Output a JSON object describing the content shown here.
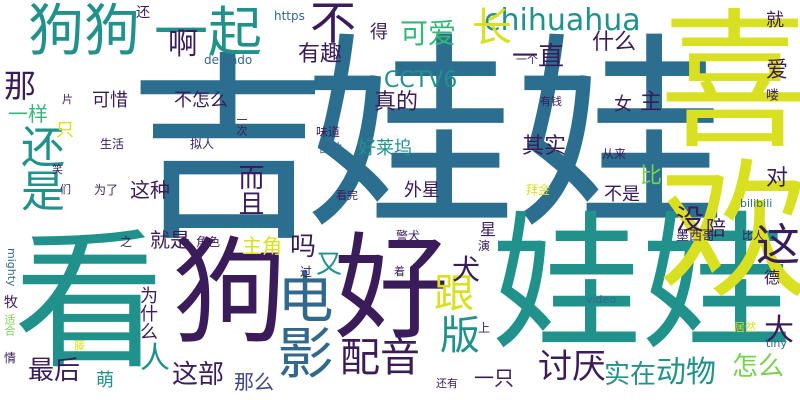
{
  "palette": {
    "teal_dark": "#2c6e8f",
    "teal": "#21918c",
    "green": "#35b779",
    "lime": "#7ad151",
    "yellow": "#d9e021",
    "purple": "#3b1c5a",
    "indigo": "#414487",
    "blue": "#31688e"
  },
  "words": {
    "ji": "吉",
    "wawa1": "娃娃",
    "wawa2": "娃娃",
    "xihuan": "喜欢",
    "kan": "看",
    "gou": "狗",
    "hao": "好",
    "gougou": "狗狗",
    "yiqi": "一起",
    "bu": "不",
    "chihuahua": "chihuahua",
    "haishi": "还是",
    "dianying": "电影",
    "zhe": "这",
    "peiyin": "配音",
    "ban": "版",
    "gen": "跟",
    "quan": "犬",
    "taoyan": "讨厌",
    "dongwu": "动物",
    "shizai": "实在",
    "zenme": "怎么",
    "da": "大",
    "zuihou": "最后",
    "zhebu": "这部",
    "name": "那么",
    "ren": "人",
    "mei": "没",
    "ma": "吗",
    "you": "又",
    "youqu": "有趣",
    "cctv6": "CCTV6",
    "a": "啊",
    "keai": "可爱",
    "chang": "长",
    "yizhi": "一直",
    "shenme": "什么",
    "na": "那",
    "yiyang": "一样",
    "kexi": "可惜",
    "buzenme": "不怎么",
    "zhende": "真的",
    "qishi": "其实",
    "haolaiwu": "好莱坞",
    "waixing": "外星",
    "bushi": "不是",
    "zhezhong": "这种",
    "erqie": "而且",
    "jiushi": "就是",
    "zhujiao": "主角",
    "weishenme": "为什么",
    "yizhi2": "一只",
    "meng": "萌",
    "ai": "爱",
    "zhu": "主",
    "nv": "女",
    "bi": "比",
    "dui": "对",
    "pei": "陪",
    "jiu": "就",
    "de": "得",
    "kele": "可乐",
    "huan": "还",
    "https": "https",
    "delgado": "delgado",
    "yige": "一个",
    "weidao": "味道",
    "youqian": "有钱",
    "shenghuo": "生活",
    "niren": "拟人",
    "yici": "一次",
    "gezhong": "各种",
    "congla": "从来",
    "meixige": "墨西哥",
    "bilibili": "bilibili",
    "bairen": "比人",
    "jingquan": "警犬",
    "xing": "星",
    "yan": "演",
    "guo": "过",
    "zhe2": "着",
    "juese": "角色",
    "zhi": "之",
    "weile": "为了",
    "men": "们",
    "xiao": "笑",
    "zhi3": "只",
    "jiaojin": "拜金",
    "kanwan": "看完",
    "mighty": "mighty",
    "shihe": "适合",
    "mu": "牧",
    "qing": "情",
    "teng": "藤",
    "haiyou": "还有",
    "shang": "上",
    "video": "video",
    "juran": "居然",
    "tiny": "tiny",
    "de2": "德",
    "pian": "片",
    "xiangqing": "相",
    "qingjie": "情节",
    "lou": "喽",
    "duo": "多"
  }
}
